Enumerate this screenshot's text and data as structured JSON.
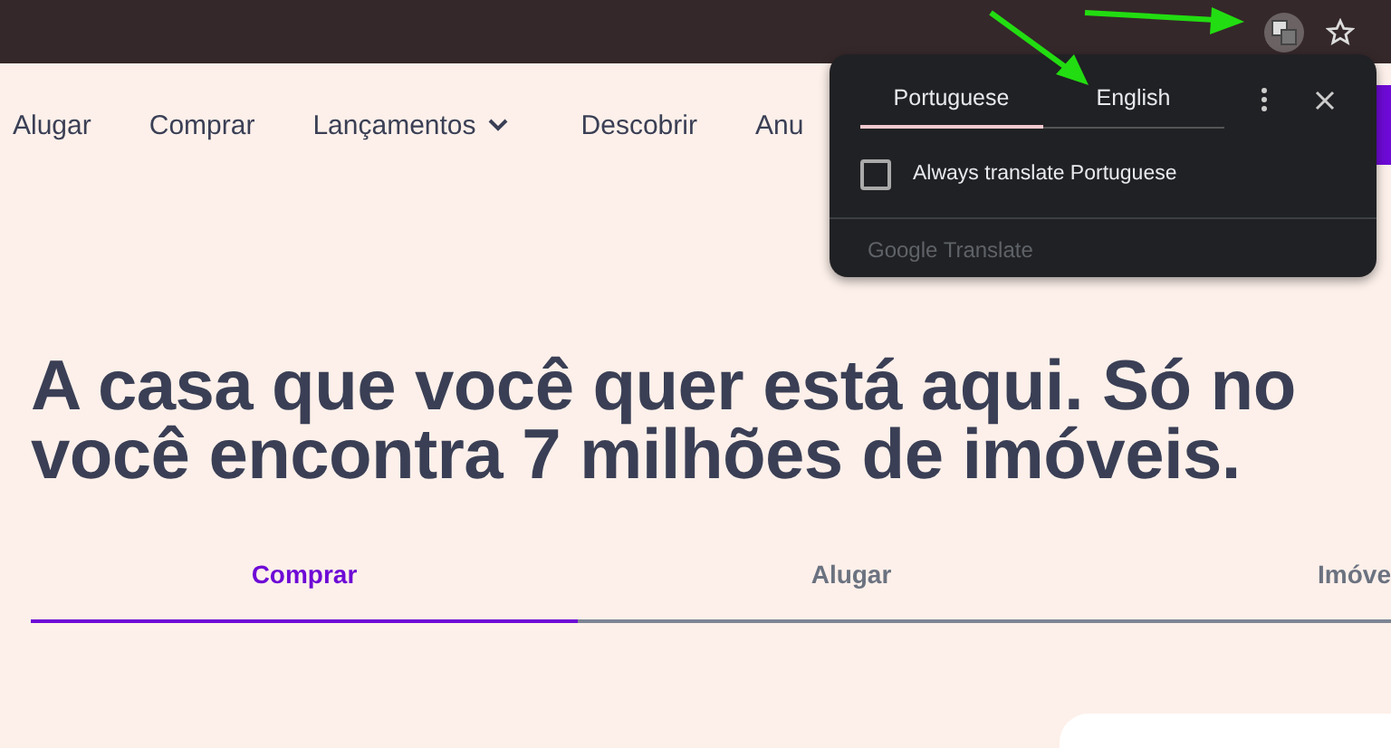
{
  "nav": {
    "items": [
      {
        "label": "Alugar",
        "dropdown": false
      },
      {
        "label": "Comprar",
        "dropdown": false
      },
      {
        "label": "Lançamentos",
        "dropdown": true
      },
      {
        "label": "Descobrir",
        "dropdown": false
      },
      {
        "label": "Anu",
        "dropdown": false
      }
    ]
  },
  "headline": [
    "A casa que você quer está aqui. Só no",
    "você encontra 7 milhões de imóveis."
  ],
  "search_tabs": [
    {
      "label": "Comprar",
      "selected": true
    },
    {
      "label": "Alugar",
      "selected": false
    },
    {
      "label": "Imóve",
      "selected": false
    }
  ],
  "translate_popup": {
    "tabs": [
      {
        "label": "Portuguese",
        "selected": true
      },
      {
        "label": "English",
        "selected": false
      }
    ],
    "option": {
      "label": "Always translate Portuguese",
      "checked": false
    },
    "footer": "Google Translate"
  }
}
